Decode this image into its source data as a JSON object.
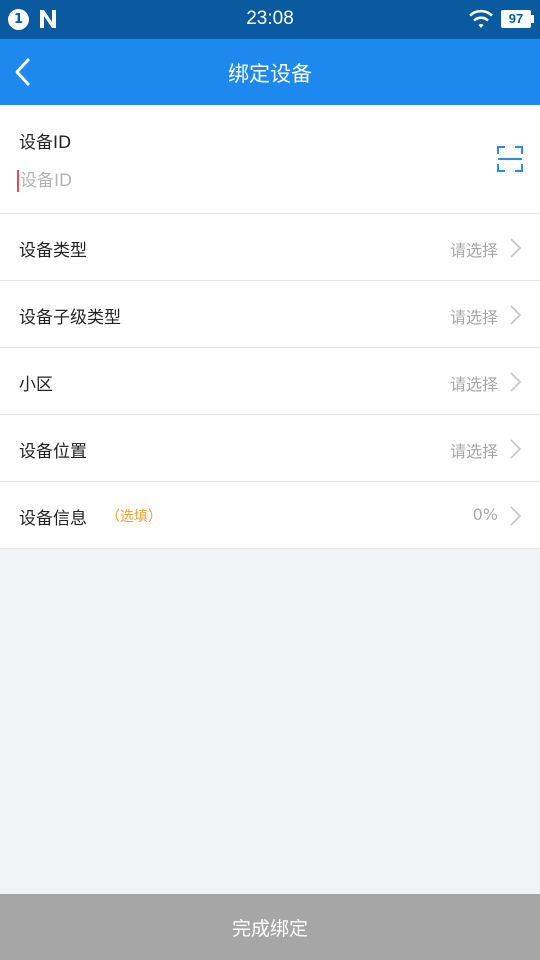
{
  "status_bar": {
    "notification_count": "1",
    "time": "23:08",
    "battery": "97"
  },
  "nav": {
    "back_icon": "chevron-left-icon",
    "title": "绑定设备"
  },
  "device_id": {
    "label": "设备ID",
    "placeholder": "设备ID",
    "value": "",
    "scan_icon": "scan-icon"
  },
  "rows": [
    {
      "label": "设备类型",
      "value": "请选择"
    },
    {
      "label": "设备子级类型",
      "value": "请选择"
    },
    {
      "label": "小区",
      "value": "请选择"
    },
    {
      "label": "设备位置",
      "value": "请选择"
    },
    {
      "label": "设备信息",
      "optional": "（选填）",
      "value": "0%"
    }
  ],
  "submit": {
    "label": "完成绑定"
  },
  "colors": {
    "status_bar": "#0a5aa0",
    "nav_bar": "#1d88ee",
    "optional_text": "#f0a22e",
    "submit_bg": "#a6a6a6",
    "page_bg": "#f2f3f5"
  }
}
